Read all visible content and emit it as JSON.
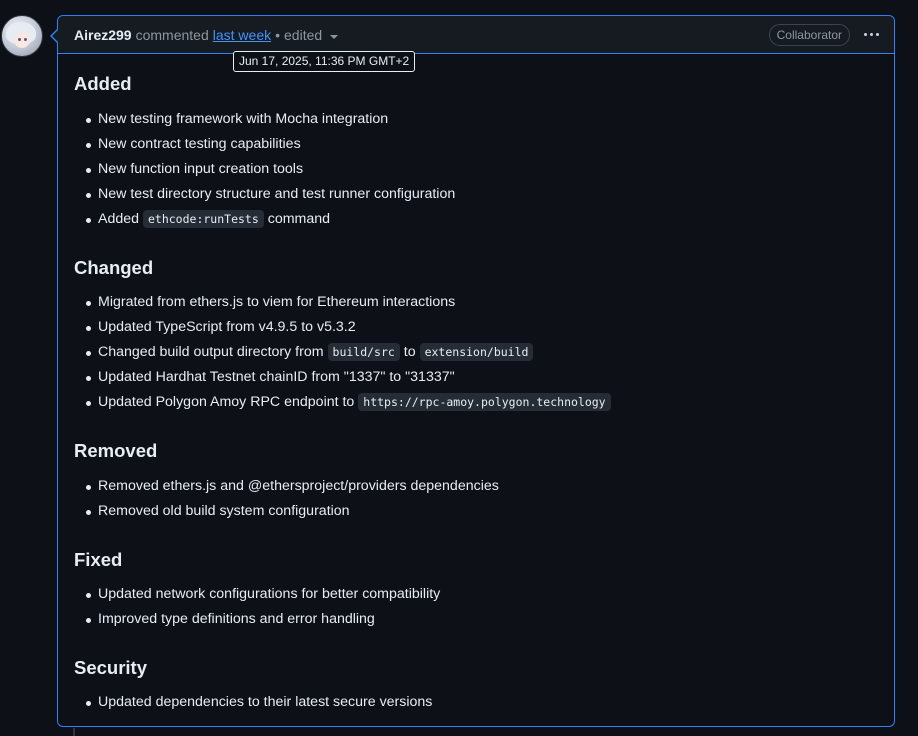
{
  "comment": {
    "author": "Airez299",
    "action": "commented",
    "time_link": "last week",
    "separator": "•",
    "edited": "edited",
    "role": "Collaborator",
    "tooltip": "Jun 17, 2025, 11:36 PM GMT+2"
  },
  "sections": {
    "added": {
      "heading": "Added",
      "items": [
        "New testing framework with Mocha integration",
        "New contract testing capabilities",
        "New function input creation tools",
        "New test directory structure and test runner configuration"
      ],
      "item5_pre": "Added",
      "item5_code": "ethcode:runTests",
      "item5_post": "command"
    },
    "changed": {
      "heading": "Changed",
      "items": [
        "Migrated from ethers.js to viem for Ethereum interactions",
        "Updated TypeScript from v4.9.5 to v5.3.2"
      ],
      "item3_pre": "Changed build output directory from",
      "item3_code1": "build/src",
      "item3_mid": "to",
      "item3_code2": "extension/build",
      "item4": "Updated Hardhat Testnet chainID from \"1337\" to \"31337\"",
      "item5_pre": "Updated Polygon Amoy RPC endpoint to",
      "item5_code": "https://rpc-amoy.polygon.technology"
    },
    "removed": {
      "heading": "Removed",
      "items": [
        "Removed ethers.js and @ethersproject/providers dependencies",
        "Removed old build system configuration"
      ]
    },
    "fixed": {
      "heading": "Fixed",
      "items": [
        "Updated network configurations for better compatibility",
        "Improved type definitions and error handling"
      ]
    },
    "security": {
      "heading": "Security",
      "items": [
        "Updated dependencies to their latest secure versions"
      ]
    }
  }
}
